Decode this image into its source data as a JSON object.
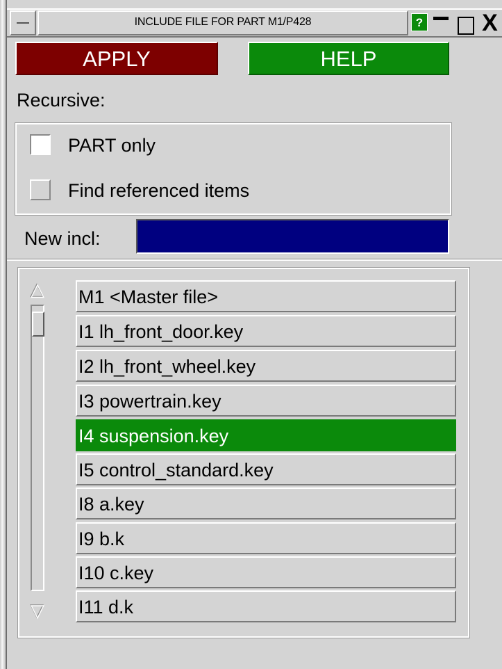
{
  "window": {
    "title": "INCLUDE FILE FOR PART M1/P428",
    "help_icon": "?",
    "close_glyph": "X"
  },
  "buttons": {
    "apply": "APPLY",
    "help": "HELP"
  },
  "recursive": {
    "label": "Recursive:",
    "options": [
      {
        "label": "PART only",
        "checked": false
      },
      {
        "label": "Find referenced items",
        "checked": false
      }
    ]
  },
  "new_include": {
    "label": "New incl:",
    "value": ""
  },
  "scroll": {
    "up": "△",
    "down": "▽"
  },
  "include_list": {
    "items": [
      {
        "label": "M1  <Master file>",
        "selected": false
      },
      {
        "label": "I1 lh_front_door.key",
        "selected": false
      },
      {
        "label": "I2 lh_front_wheel.key",
        "selected": false
      },
      {
        "label": "I3 powertrain.key",
        "selected": false
      },
      {
        "label": "I4 suspension.key",
        "selected": true
      },
      {
        "label": "I5 control_standard.key",
        "selected": false
      },
      {
        "label": "I8 a.key",
        "selected": false
      },
      {
        "label": "I9 b.k",
        "selected": false
      },
      {
        "label": "I10 c.key",
        "selected": false
      },
      {
        "label": "I11 d.k",
        "selected": false
      }
    ]
  },
  "colors": {
    "apply_bg": "#7d0000",
    "help_bg": "#0b8a0b",
    "selected_row_bg": "#0b8a0b",
    "input_bg": "#000080",
    "panel_bg": "#d4d4d4"
  }
}
